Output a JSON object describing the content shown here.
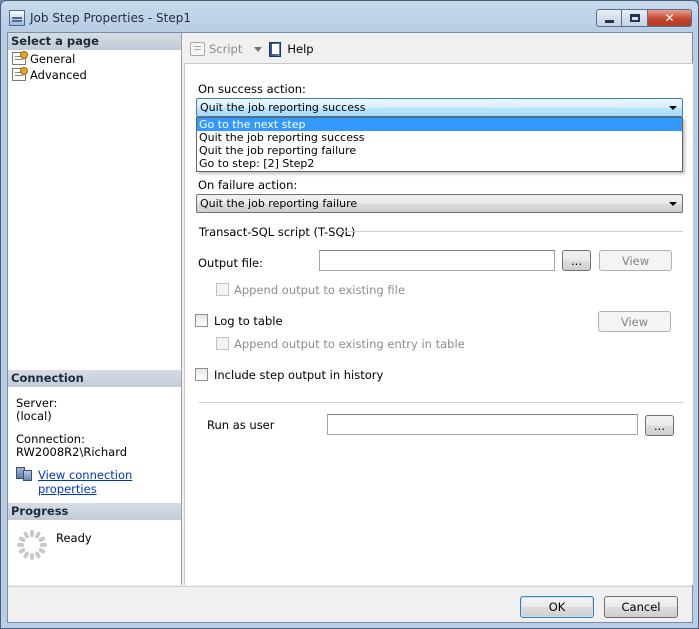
{
  "window": {
    "title": "Job Step Properties - Step1",
    "controls": {
      "minimize": "minimize-icon",
      "maximize": "maximize-icon",
      "close": "close-icon"
    }
  },
  "left": {
    "select_page_header": "Select a page",
    "pages": [
      {
        "label": "General",
        "icon": "page-icon"
      },
      {
        "label": "Advanced",
        "icon": "page-icon"
      }
    ],
    "connection": {
      "header": "Connection",
      "server_label": "Server:",
      "server_value": "(local)",
      "connection_label": "Connection:",
      "connection_value": "RW2008R2\\Richard",
      "view_link": "View connection properties"
    },
    "progress": {
      "header": "Progress",
      "status": "Ready"
    }
  },
  "toolbar": {
    "script_label": "Script",
    "help_label": "Help"
  },
  "form": {
    "success_label": "On success action:",
    "success_value": "Quit the job reporting success",
    "success_options": [
      "Go to the next step",
      "Quit the job reporting success",
      "Quit the job reporting failure",
      "Go to step: [2] Step2"
    ],
    "success_highlighted": "Go to the next step",
    "failure_label": "On failure action:",
    "failure_value": "Quit the job reporting failure",
    "tsql_group": "Transact-SQL script (T-SQL)",
    "output_file_label": "Output file:",
    "output_file_value": "",
    "browse_label": "...",
    "view_label": "View",
    "append_output_label": "Append output to existing file",
    "log_to_table_label": "Log to table",
    "append_entry_label": "Append output to existing entry in table",
    "include_history_label": "Include step output in history",
    "run_as_label": "Run as user",
    "run_as_value": ""
  },
  "footer": {
    "ok_label": "OK",
    "cancel_label": "Cancel"
  }
}
